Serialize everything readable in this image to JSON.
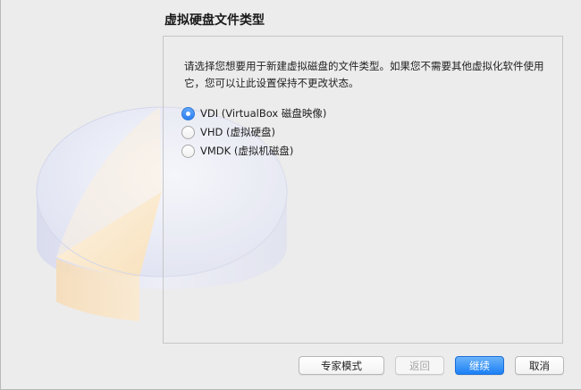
{
  "wizard": {
    "title": "虚拟硬盘文件类型",
    "description": "请选择您想要用于新建虚拟磁盘的文件类型。如果您不需要其他虚拟化软件使用它，您可以让此设置保持不更改状态。",
    "options": [
      {
        "label": "VDI (VirtualBox 磁盘映像)",
        "selected": true
      },
      {
        "label": "VHD (虚拟硬盘)",
        "selected": false
      },
      {
        "label": "VMDK (虚拟机磁盘)",
        "selected": false
      }
    ]
  },
  "buttons": {
    "expert": "专家模式",
    "back": "返回",
    "continue": "继续",
    "cancel": "取消"
  },
  "colors": {
    "accent": "#2b7ff2",
    "window_bg": "#ececec"
  }
}
